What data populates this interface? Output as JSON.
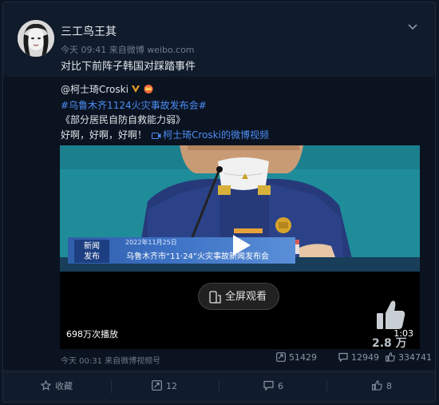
{
  "post": {
    "username": "三工鸟王其",
    "meta": "今天 09:41 来自微博 weibo.com",
    "text": "对比下前阵子韩国对踩踏事件"
  },
  "repost": {
    "author": "@柯士琦Croski",
    "hashtag": "#乌鲁木齐1124火灾事故发布会#",
    "title": "《部分居民自防自救能力弱》",
    "line_text": "好啊，好啊，好啊！",
    "video_link": "柯士琦Croski的微博视频",
    "time": "今天 00:31 来自微博视频号",
    "stats": {
      "reposts": "51429",
      "comments": "12949",
      "likes": "334741"
    }
  },
  "video": {
    "banner_tag_line1": "新闻",
    "banner_tag_line2": "发布",
    "date": "2022年11月25日",
    "banner_title": "乌鲁木齐市“11·24”火灾事故新闻发布会",
    "fullscreen_label": "全屏观看",
    "plays": "698万次播放",
    "duration": "1:03",
    "like_count": "2.8 万"
  },
  "actions": {
    "favorite": "收藏",
    "repost": "12",
    "comment": "6",
    "like": "8"
  },
  "colors": {
    "link": "#4c8df5",
    "background": "#101b2b"
  }
}
